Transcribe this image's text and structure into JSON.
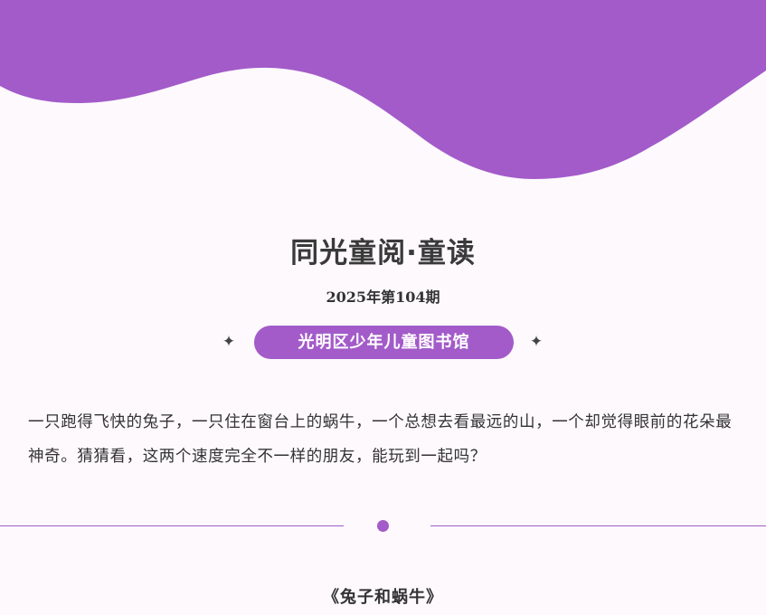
{
  "header": {
    "title": "同光童阅·童读",
    "issue": "2025年第104期",
    "tag": "光明区少年儿童图书馆",
    "sparkle_glyph": "✦"
  },
  "intro": {
    "text": "一只跑得飞快的兔子，一只住在窗台上的蜗牛，一个总想去看最远的山，一个却觉得眼前的花朵最神奇。猜猜看，这两个速度完全不一样的朋友，能玩到一起吗？"
  },
  "story": {
    "title": "《兔子和蜗牛》"
  },
  "colors": {
    "accent": "#a35bc9",
    "background": "#fdf9fd",
    "text": "#333333"
  }
}
